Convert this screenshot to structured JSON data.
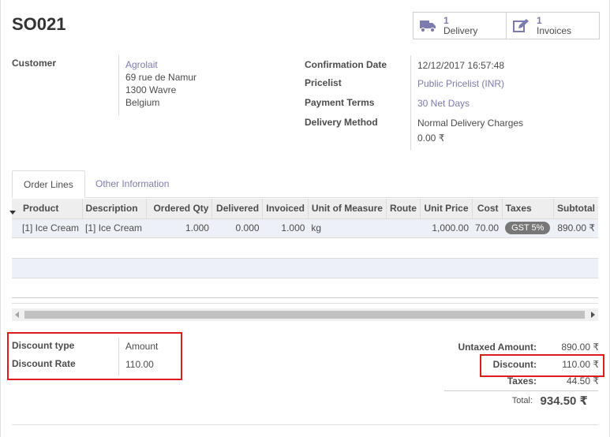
{
  "order": {
    "name": "SO021"
  },
  "smart_buttons": [
    {
      "count": "1",
      "label": "Delivery",
      "icon": "truck-icon"
    },
    {
      "count": "1",
      "label": "Invoices",
      "icon": "edit-invoice-icon"
    }
  ],
  "customer": {
    "label": "Customer",
    "name": "Agrolait",
    "street": "69 rue de Namur",
    "city": "1300 Wavre",
    "country": "Belgium"
  },
  "info": {
    "confirmation_date_label": "Confirmation Date",
    "confirmation_date": "12/12/2017 16:57:48",
    "pricelist_label": "Pricelist",
    "pricelist": "Public Pricelist (INR)",
    "payment_terms_label": "Payment Terms",
    "payment_terms": "30 Net Days",
    "delivery_method_label": "Delivery Method",
    "delivery_method": "Normal Delivery Charges",
    "delivery_cost": "0.00 ₹"
  },
  "tabs": [
    {
      "label": "Order Lines",
      "active": true
    },
    {
      "label": "Other Information",
      "active": false
    }
  ],
  "lines": {
    "headers": [
      "Product",
      "Description",
      "Ordered Qty",
      "Delivered",
      "Invoiced",
      "Unit of Measure",
      "Route",
      "Unit Price",
      "Cost",
      "Taxes",
      "Subtotal"
    ],
    "rows": [
      {
        "product": "[1] Ice Cream",
        "description": "[1] Ice Cream",
        "ordered_qty": "1.000",
        "delivered": "0.000",
        "invoiced": "1.000",
        "uom": "kg",
        "route": "",
        "unit_price": "1,000.00",
        "cost": "70.00",
        "taxes": "GST 5%",
        "subtotal": "890.00 ₹"
      }
    ]
  },
  "discount": {
    "type_label": "Discount type",
    "type_value": "Amount",
    "rate_label": "Discount Rate",
    "rate_value": "110.00"
  },
  "totals": {
    "untaxed_label": "Untaxed Amount:",
    "untaxed_value": "890.00 ₹",
    "discount_label": "Discount:",
    "discount_value": "110.00 ₹",
    "taxes_label": "Taxes:",
    "taxes_value": "44.50 ₹",
    "total_label": "Total:",
    "total_value": "934.50 ₹"
  },
  "colors": {
    "link": "#7c7bad",
    "highlight_box": "#e01b1b",
    "tax_tag": "#777777"
  }
}
